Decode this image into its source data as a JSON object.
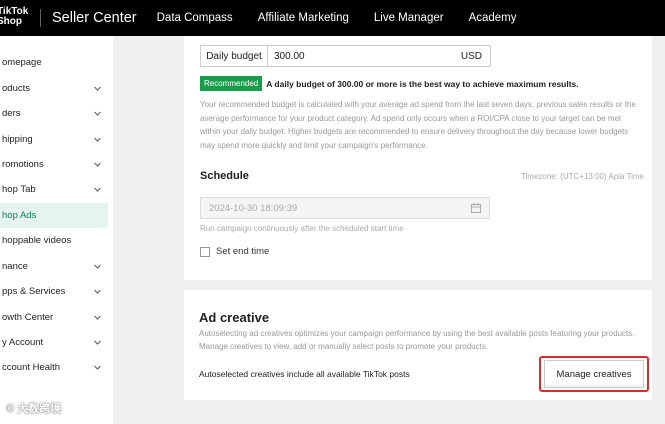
{
  "topbar": {
    "logo_line1": "TikTok",
    "logo_line2": "Shop",
    "brand": "Seller Center",
    "nav": [
      "Data Compass",
      "Affiliate Marketing",
      "Live Manager",
      "Academy"
    ]
  },
  "sidebar": {
    "items": [
      {
        "label": "omepage",
        "chevron": false,
        "active": false
      },
      {
        "label": "oducts",
        "chevron": true,
        "active": false
      },
      {
        "label": "ders",
        "chevron": true,
        "active": false
      },
      {
        "label": "hipping",
        "chevron": true,
        "active": false
      },
      {
        "label": "romotions",
        "chevron": true,
        "active": false
      },
      {
        "label": "hop Tab",
        "chevron": true,
        "active": false
      },
      {
        "label": "hop Ads",
        "chevron": false,
        "active": true
      },
      {
        "label": "hoppable videos",
        "chevron": false,
        "active": false
      },
      {
        "label": "nance",
        "chevron": true,
        "active": false
      },
      {
        "label": "pps & Services",
        "chevron": true,
        "active": false
      },
      {
        "label": "owth Center",
        "chevron": true,
        "active": false
      },
      {
        "label": "y Account",
        "chevron": true,
        "active": false
      },
      {
        "label": "ccount Health",
        "chevron": true,
        "active": false
      }
    ]
  },
  "budget": {
    "label": "Daily budget",
    "value": "300.00",
    "currency": "USD",
    "badge": "Recommended",
    "recommendation": "A daily budget of 300.00 or more is the best way to achieve maximum results.",
    "explanation": "Your recommended budget is calculated with your average ad spend from the last seven days, previous sales results or the average performance for your product category. Ad spend only occurs when a ROI/CPA close to your target can be met within your daily budget. Higher budgets are recommended to ensure delivery throughout the day because lower budgets may spend more quickly and limit your campaign's performance."
  },
  "schedule": {
    "title": "Schedule",
    "timezone": "Timezone: (UTC+13:00) Apia Time",
    "start_value": "2024-10-30 18:09:39",
    "note": "Run campaign continuously after the scheduled start time",
    "end_time_label": "Set end time"
  },
  "ad_creative": {
    "title": "Ad creative",
    "description": "Autoselecting ad creatives optimizes your campaign performance by using the best available posts featuring your products. Manage creatives to view, add or manually select posts to promote your products.",
    "auto_note": "Autoselected creatives include all available TikTok posts",
    "manage_button": "Manage creatives"
  },
  "watermark": "© 大数跨境"
}
